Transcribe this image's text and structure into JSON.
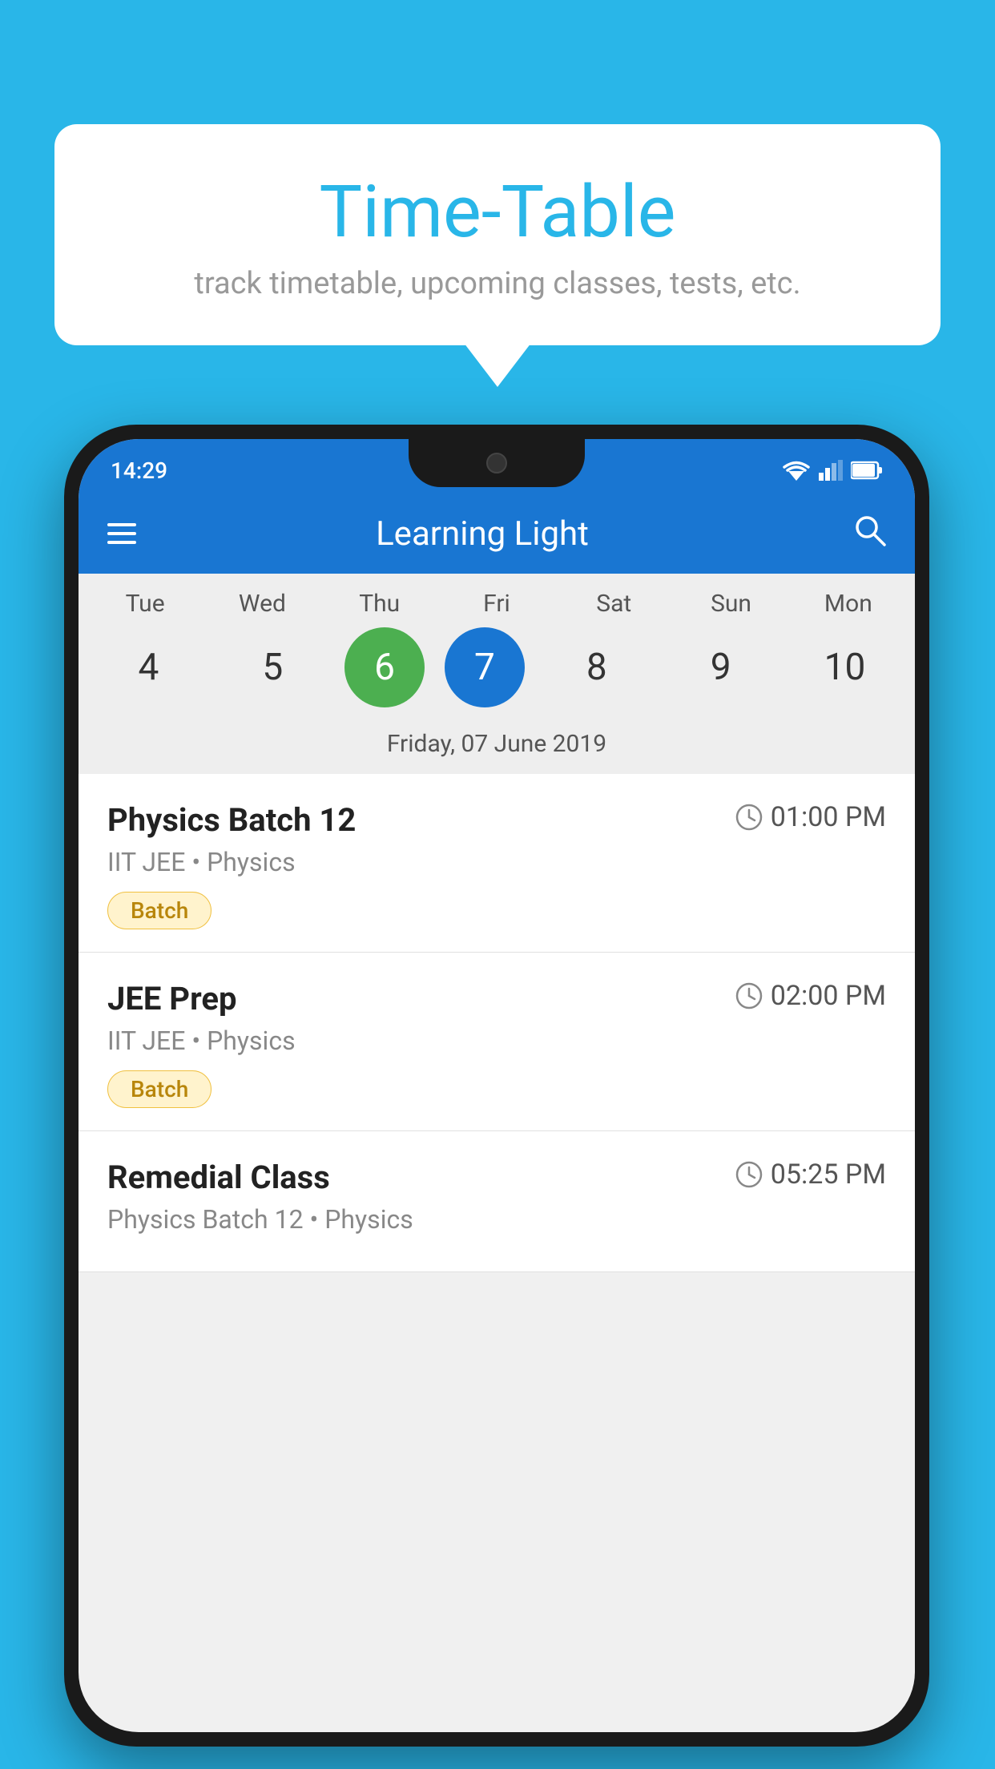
{
  "background_color": "#29b6e8",
  "bubble": {
    "title": "Time-Table",
    "subtitle": "track timetable, upcoming classes, tests, etc."
  },
  "phone": {
    "status_bar": {
      "time": "14:29"
    },
    "app_bar": {
      "title": "Learning Light",
      "menu_icon": "hamburger-icon",
      "search_icon": "search-icon"
    },
    "calendar": {
      "days": [
        {
          "label": "Tue",
          "number": "4"
        },
        {
          "label": "Wed",
          "number": "5"
        },
        {
          "label": "Thu",
          "number": "6",
          "state": "today"
        },
        {
          "label": "Fri",
          "number": "7",
          "state": "selected"
        },
        {
          "label": "Sat",
          "number": "8"
        },
        {
          "label": "Sun",
          "number": "9"
        },
        {
          "label": "Mon",
          "number": "10"
        }
      ],
      "selected_date_label": "Friday, 07 June 2019"
    },
    "schedule": [
      {
        "title": "Physics Batch 12",
        "time": "01:00 PM",
        "subtitle": "IIT JEE • Physics",
        "tag": "Batch"
      },
      {
        "title": "JEE Prep",
        "time": "02:00 PM",
        "subtitle": "IIT JEE • Physics",
        "tag": "Batch"
      },
      {
        "title": "Remedial Class",
        "time": "05:25 PM",
        "subtitle": "Physics Batch 12 • Physics",
        "tag": null
      }
    ]
  }
}
